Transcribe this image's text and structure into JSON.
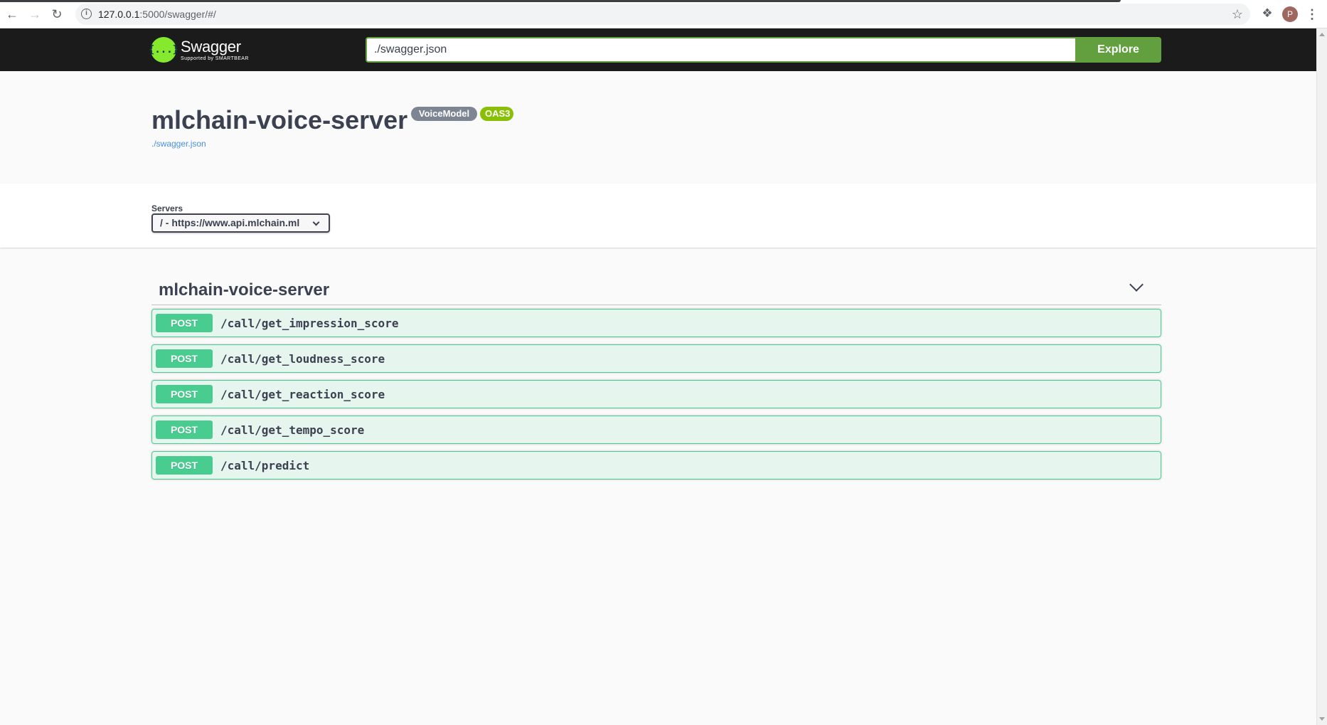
{
  "browser": {
    "url_host": "127.0.0.1",
    "url_rest": ":5000/swagger/#/",
    "avatar_letter": "P",
    "icons": {
      "back": "arrow-left-icon",
      "forward": "arrow-right-icon",
      "reload": "reload-icon",
      "info": "info-icon",
      "bookmark": "star-icon",
      "extensions": "puzzle-icon",
      "menu": "kebab-menu-icon"
    }
  },
  "topbar": {
    "logo_name": "Swagger",
    "logo_subtitle": "Supported by SMARTBEAR",
    "explore_value": "./swagger.json",
    "explore_label": "Explore",
    "colors": {
      "background": "#1b1b1b",
      "accent": "#62a03f",
      "logo": "#85ea2d"
    }
  },
  "info": {
    "title": "mlchain-voice-server",
    "version_badge": "VoiceModel",
    "oas_badge": "OAS3",
    "spec_link": "./swagger.json"
  },
  "servers": {
    "label": "Servers",
    "selected": "/ - https://www.api.mlchain.ml"
  },
  "tag": {
    "name": "mlchain-voice-server",
    "expanded": true,
    "operations": [
      {
        "method": "POST",
        "path": "/call/get_impression_score"
      },
      {
        "method": "POST",
        "path": "/call/get_loudness_score"
      },
      {
        "method": "POST",
        "path": "/call/get_reaction_score"
      },
      {
        "method": "POST",
        "path": "/call/get_tempo_score"
      },
      {
        "method": "POST",
        "path": "/call/predict"
      }
    ],
    "colors": {
      "post": "#49cc90"
    }
  }
}
